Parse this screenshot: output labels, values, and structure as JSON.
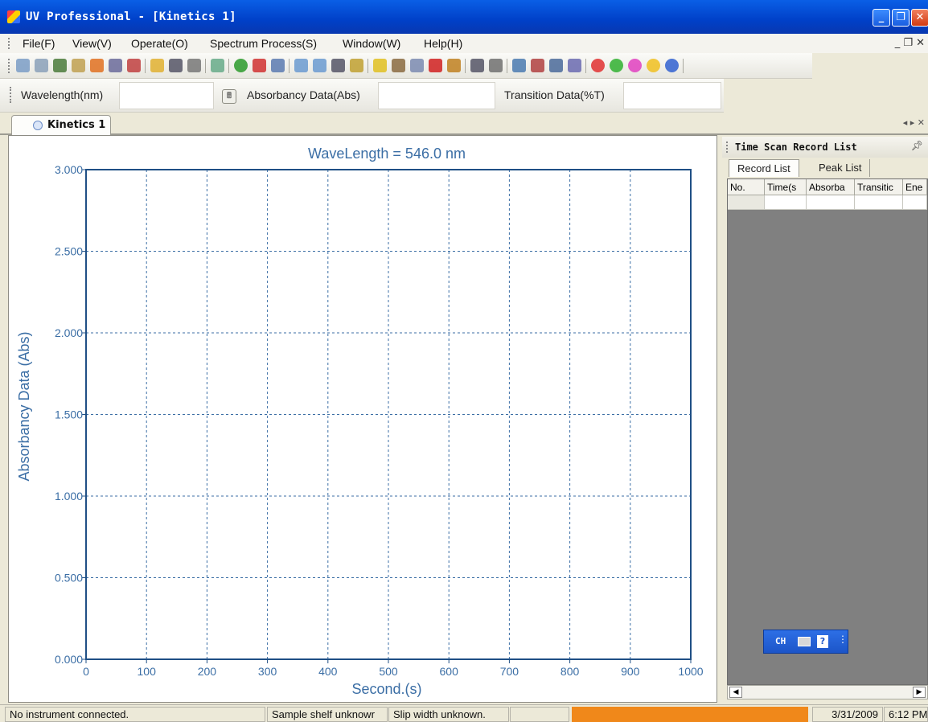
{
  "window": {
    "title": "UV Professional - [Kinetics 1]",
    "controls": {
      "minimize": "_",
      "restore": "❐",
      "close": "✕"
    },
    "accent_color": "#0a5fe6"
  },
  "menu": {
    "items": [
      "File(F)",
      "View(V)",
      "Operate(O)",
      "Spectrum Process(S)",
      "Window(W)",
      "Help(H)"
    ],
    "mdi_controls": "_ ❐ ✕"
  },
  "toolbar": {
    "icons": [
      "new-doc-icon",
      "chart-icon",
      "flask-icon",
      "lamp-icon",
      "bars-icon",
      "grid-icon",
      "s-icon",
      "open-folder-icon",
      "save-icon",
      "print-icon",
      "pencil-icon",
      "green-run-icon",
      "red-stop-icon",
      "edit-doc-icon",
      "zoom-in-icon",
      "zoom-out-icon",
      "text-label-icon",
      "bulb-off-icon",
      "bulb-on-icon",
      "pipette-icon",
      "peak-pick-icon",
      "delete-icon",
      "bar-chart-icon",
      "align-icon",
      "tools-icon",
      "print-preview-icon",
      "line-chart-icon",
      "table-icon",
      "undo-icon",
      "add-red-icon",
      "add-green-icon",
      "remove-magenta-icon",
      "minus-yellow-icon",
      "blue-settings-icon"
    ]
  },
  "databar": {
    "wavelength_label": "Wavelength(nm)",
    "wavelength_value": "",
    "absorbancy_label": "Absorbancy Data(Abs)",
    "absorbancy_value": "",
    "transition_label": "Transition Data(%T)",
    "transition_value": ""
  },
  "tabs": {
    "document_tab": "Kinetics 1",
    "nav": "◂ ▸ ✕"
  },
  "chart_data": {
    "type": "line",
    "title": "WaveLength = 546.0 nm",
    "xlabel": "Second.(s)",
    "ylabel": "Absorbancy Data (Abs)",
    "xlim": [
      0,
      1000
    ],
    "ylim": [
      0.0,
      3.0
    ],
    "x_ticks": [
      "0",
      "100",
      "200",
      "300",
      "400",
      "500",
      "600",
      "700",
      "800",
      "900",
      "1000"
    ],
    "y_ticks": [
      "0.000",
      "0.500",
      "1.000",
      "1.500",
      "2.000",
      "2.500",
      "3.000"
    ],
    "grid": true,
    "series": []
  },
  "side_panel": {
    "title": "Time Scan Record List",
    "tabs": [
      "Record List",
      "Peak List"
    ],
    "columns": [
      "No.",
      "Time(s",
      "Absorba",
      "Transitic",
      "Ene"
    ],
    "float_toolbar_label": "CH"
  },
  "statusbar": {
    "instrument": "No instrument connected.",
    "sample_shelf": "Sample shelf unknowr",
    "slip_width": "Slip width unknown.",
    "date": "3/31/2009",
    "time": "6:12 PM",
    "progress_color": "#f0881a"
  }
}
